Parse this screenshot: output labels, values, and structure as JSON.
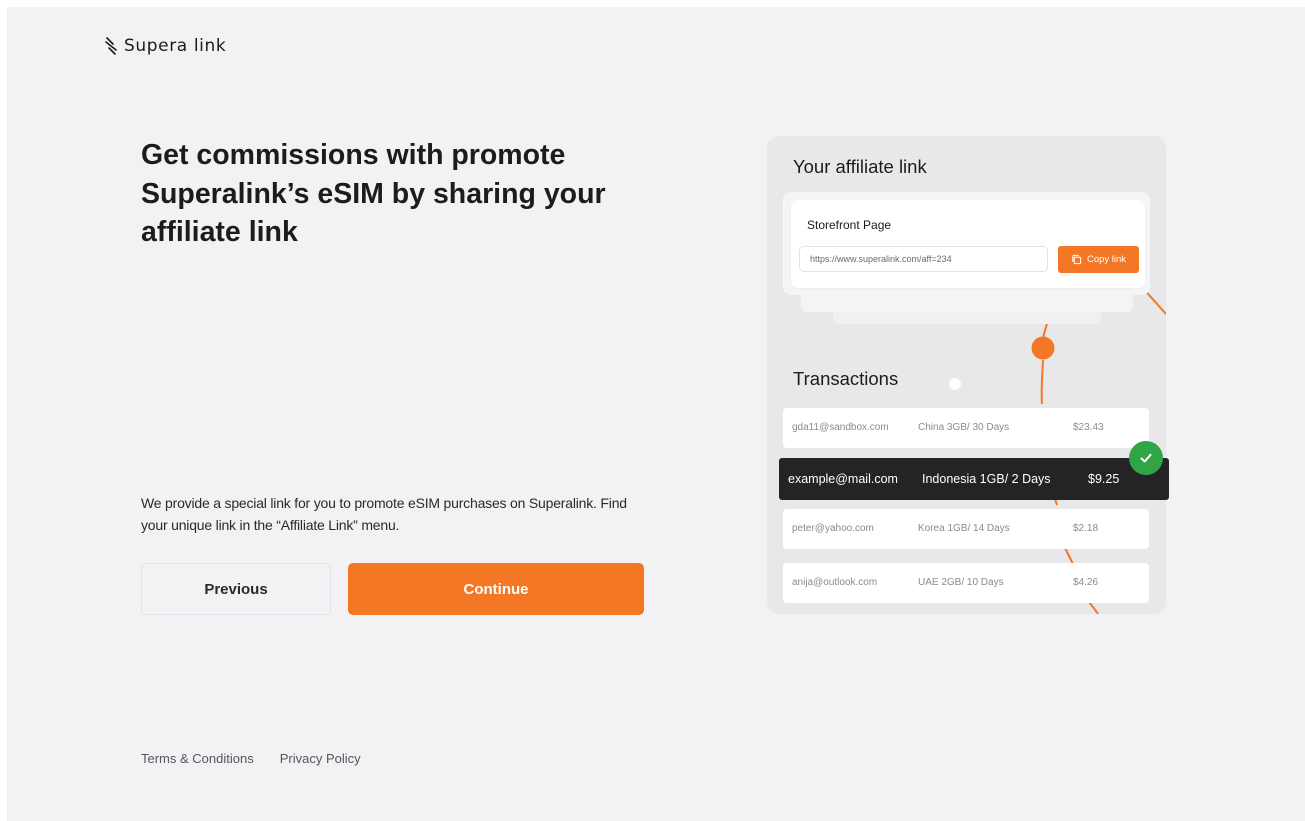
{
  "brand": {
    "name": "Supera link",
    "accent_color": "#f47726"
  },
  "onboarding": {
    "headline": "Get commissions with promote Superalink’s eSIM by sharing your affiliate link",
    "description": "We provide a special link for you to promote eSIM purchases on Superalink. Find your unique link in the “Affiliate Link” menu.",
    "previous_label": "Previous",
    "continue_label": "Continue"
  },
  "footer": {
    "terms": "Terms & Conditions",
    "privacy": "Privacy Policy"
  },
  "illustration": {
    "affiliate_title": "Your affiliate link",
    "storefront_label": "Storefront Page",
    "affiliate_url": "https://www.superalink.com/aff=234",
    "copy_label": "Copy link",
    "copy_icon": "copy-icon",
    "transactions_title": "Transactions",
    "transactions": [
      {
        "email": "gda11@sandbox.com",
        "plan": "China 3GB/ 30 Days",
        "amount": "$23.43"
      },
      {
        "email": "example@mail.com",
        "plan": "Indonesia 1GB/ 2 Days",
        "amount": "$9.25",
        "highlighted": true
      },
      {
        "email": "peter@yahoo.com",
        "plan": "Korea 1GB/ 14 Days",
        "amount": "$2.18"
      },
      {
        "email": "anija@outlook.com",
        "plan": "UAE 2GB/ 10 Days",
        "amount": "$4.26"
      }
    ],
    "check_icon": "check-circle-icon",
    "success_color": "#2fa546"
  }
}
